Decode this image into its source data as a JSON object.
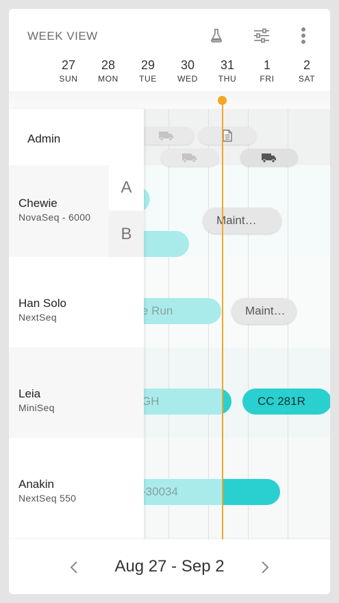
{
  "header": {
    "title": "WEEK VIEW",
    "icons": [
      "flask-icon",
      "sliders-icon",
      "more-vertical-icon"
    ],
    "days": [
      {
        "num": "27",
        "name": "SUN"
      },
      {
        "num": "28",
        "name": "MON"
      },
      {
        "num": "29",
        "name": "TUE"
      },
      {
        "num": "30",
        "name": "WED"
      },
      {
        "num": "31",
        "name": "THU"
      },
      {
        "num": "1",
        "name": "FRI"
      },
      {
        "num": "2",
        "name": "SAT"
      }
    ]
  },
  "sidebar": {
    "admin": "Admin",
    "instruments": [
      {
        "name": "Chewie",
        "model": "NovaSeq - 6000",
        "slots": [
          "A",
          "B"
        ]
      },
      {
        "name": "Han Solo",
        "model": "NextSeq"
      },
      {
        "name": "Leia",
        "model": "MiniSeq"
      },
      {
        "name": "Anakin",
        "model": "NextSeq 550"
      }
    ]
  },
  "events": {
    "chewie_maint": "Maint…",
    "hansolo_run": "e Run",
    "hansolo_maint": "Maint…",
    "leia_run": "GH",
    "leia_cc": "CC 281R",
    "anakin_run": "-30034"
  },
  "footer": {
    "range": "Aug 27 - Sep 2"
  },
  "colors": {
    "accent": "#f5a623",
    "teal": "#2ad0d0",
    "teal_light": "#a9ebeb",
    "gray_pill": "#e6e6e6"
  }
}
